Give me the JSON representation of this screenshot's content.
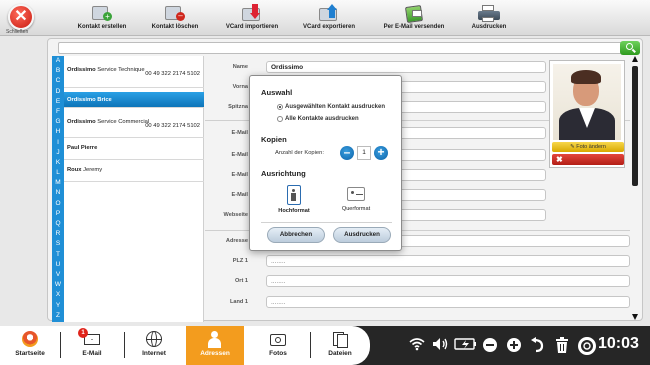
{
  "toolbar": {
    "close_label": "Schließen",
    "buttons": [
      {
        "label": "Kontakt erstellen"
      },
      {
        "label": "Kontakt löschen"
      },
      {
        "label": "VCard importieren"
      },
      {
        "label": "VCard exportieren"
      },
      {
        "label": "Per E-Mail versenden"
      },
      {
        "label": "Ausdrucken"
      }
    ]
  },
  "alphabet": [
    "A",
    "B",
    "C",
    "D",
    "E",
    "F",
    "G",
    "H",
    "I",
    "J",
    "K",
    "L",
    "M",
    "N",
    "O",
    "P",
    "Q",
    "R",
    "S",
    "T",
    "U",
    "V",
    "W",
    "X",
    "Y",
    "Z"
  ],
  "contacts": [
    {
      "name": "Ordissimo",
      "sub": "Service Technique",
      "phone": "00 49 322 2174 5102"
    },
    {
      "name": "Ordissimo Brice",
      "sub": "",
      "phone": ""
    },
    {
      "name": "Ordissimo",
      "sub": "Service Commercial",
      "phone": "00 49 322 2174 5102"
    },
    {
      "name": "Paul Pierre",
      "sub": "",
      "phone": ""
    },
    {
      "name": "Roux",
      "sub": "Jeremy",
      "phone": ""
    }
  ],
  "form": {
    "name_label": "Name",
    "name_value": "Ordissimo",
    "vorname_label": "Vorna",
    "spitzname_label": "Spitzna",
    "email_label": "E-Mail",
    "webseite_label": "Webseite",
    "adresse_label": "Adresse",
    "plz_label": "PLZ 1",
    "ort_label": "Ort 1",
    "land_label": "Land 1",
    "placeholder": "........"
  },
  "photo": {
    "change_label": "Foto ändern",
    "delete_symbol": "✖"
  },
  "dialog": {
    "auswahl_title": "Auswahl",
    "option_selected": "Ausgewählten Kontakt ausdrucken",
    "option_all": "Alle Kontakte ausdrucken",
    "kopien_title": "Kopien",
    "copies_label": "Anzahl der Kopien:",
    "copies_value": "1",
    "ausrichtung_title": "Ausrichtung",
    "portrait_label": "Hochformat",
    "landscape_label": "Querformat",
    "cancel_label": "Abbrechen",
    "print_label": "Ausdrucken"
  },
  "bottom_nav": {
    "tabs": [
      {
        "label": "Startseite"
      },
      {
        "label": "E-Mail"
      },
      {
        "label": "Internet"
      },
      {
        "label": "Adressen"
      },
      {
        "label": "Fotos"
      },
      {
        "label": "Dateien"
      }
    ],
    "email_badge": "1",
    "clock": "10:03"
  },
  "colors": {
    "accent_blue": "#1f8fd6",
    "active_tab": "#f39c1e",
    "close_red": "#c81a10",
    "search_green": "#2f9a1e"
  }
}
